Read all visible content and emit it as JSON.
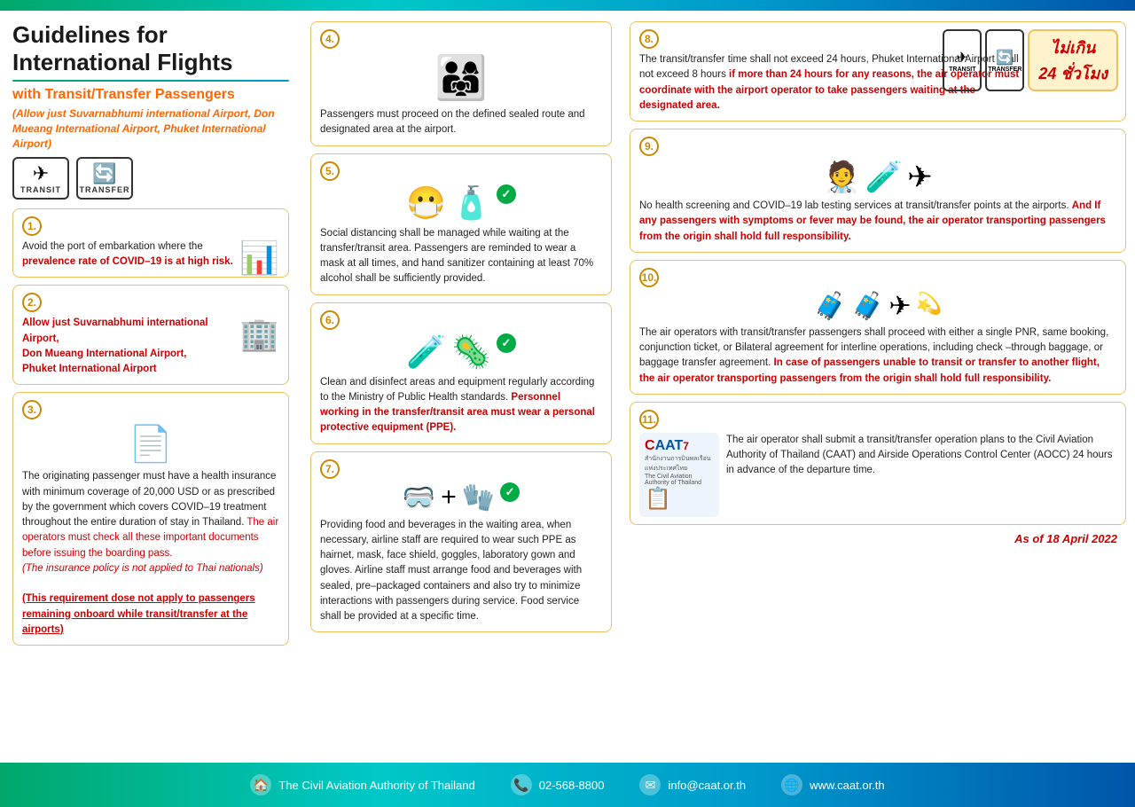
{
  "topBar": {
    "height": 12
  },
  "header": {
    "title": "Guidelines for International Flights",
    "subtitle": "with Transit/Transfer Passengers",
    "subtitleNote": "(Allow just Suvarnabhumi international Airport, Don Mueang International Airport, Phuket International Airport)",
    "transitLabel": "TRANSIT",
    "transferLabel": "TRANSFER"
  },
  "caat": {
    "logoText": "CAAT",
    "tagline": "สำนักงานการบินพลเรือนแห่งประเทศไทย\nThe Civil Aviation Authority of Thailand"
  },
  "hourBadge": {
    "notExceed": "ไม่เกิน",
    "hours": "24 ชั่วโมง"
  },
  "items": [
    {
      "num": "1",
      "text": "Avoid the port of embarkation where the ",
      "redText": "prevalence rate of COVID–19 is at high risk.",
      "icon": "📊"
    },
    {
      "num": "2",
      "redText": "Allow just Suvarnabhumi international Airport, Don Mueang International Airport, Phuket International Airport",
      "icon": "✈️"
    },
    {
      "num": "3",
      "text": "The originating passenger must have a health insurance with minimum coverage of 20,000 USD or as prescribed by the government which covers COVID–19 treatment throughout the entire duration of stay in Thailand.",
      "redText1": "The air operators must check all these important documents before issuing the boarding pass.",
      "italicText": "(The insurance policy is not applied to Thai nationals)",
      "boldUnderlineText": "(This requirement dose not apply to passengers remaining onboard while transit/transfer at the airports)",
      "icon": "📄"
    }
  ],
  "midItems": [
    {
      "num": "4",
      "text": "Passengers must proceed on the defined sealed route and designated area at the airport.",
      "icon": "👨‍👩‍👧‍👦"
    },
    {
      "num": "5",
      "text": "Social distancing shall be managed while waiting at the transfer/transit area. Passengers are reminded to wear a mask at all times, and hand sanitizer containing at least 70% alcohol shall be sufficiently provided.",
      "icon": "😷"
    },
    {
      "num": "6",
      "text": "Clean and disinfect areas and equipment regularly according to the Ministry of Public Health standards. ",
      "redText": "Personnel working in the transfer/transit area must wear a personal protective equipment (PPE).",
      "icon": "🧴"
    },
    {
      "num": "7",
      "text": "Providing food and beverages in the waiting area, when necessary, airline staff are required to wear such PPE as hairnet, mask, face shield, goggles, laboratory gown and gloves. Airline staff must arrange food and beverages with sealed, pre–packaged containers and also try to minimize interactions with passengers during service. Food service shall be provided at a specific time.",
      "icon": "🥗"
    }
  ],
  "rightItems": [
    {
      "num": "8",
      "text": "The transit/transfer time shall not exceed 24 hours, Phuket International Airport shall not exceed 8 hours ",
      "redText": "if more than 24 hours for any reasons, the air operator must coordinate with the airport operator to take passengers waiting at the designated area.",
      "icons": [
        "✈️",
        "🔄"
      ]
    },
    {
      "num": "9",
      "text": "No health screening and COVID–19 lab testing services at transit/transfer points at the airports. ",
      "redText": "And If any passengers with symptoms or fever may be found, the air operator transporting passengers from the origin shall hold full responsibility.",
      "icons": [
        "👨‍⚕️",
        "🧪",
        "✈️"
      ]
    },
    {
      "num": "10",
      "text": "The air operators with transit/transfer passengers shall proceed with either a single PNR, same booking, conjunction ticket, or Bilateral agreement for interline operations, including check –through baggage, or baggage transfer agreement. ",
      "redText": "In case of passengers unable to transit or transfer to another flight, the air operator transporting passengers from the origin shall hold full responsibility.",
      "icons": [
        "🧳",
        "✈️"
      ]
    },
    {
      "num": "11",
      "text": "The air operator shall submit a transit/transfer operation plans to the Civil Aviation Authority of Thailand (CAAT) and Airside Operations Control Center (AOCC) 24 hours in advance of the departure time.",
      "icons": [
        "📋",
        "✈️"
      ]
    }
  ],
  "asOf": "As of 18 April 2022",
  "footer": {
    "org": "The Civil Aviation Authority of Thailand",
    "phone": "02-568-8800",
    "email": "info@caat.or.th",
    "web": "www.caat.or.th"
  }
}
